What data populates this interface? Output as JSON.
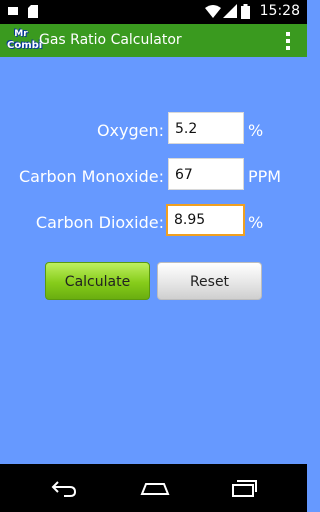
{
  "status_bar": {
    "time": "15:28"
  },
  "action_bar": {
    "logo_line1": "Mr",
    "logo_line2": "Combi",
    "title": "Gas Ratio Calculator"
  },
  "form": {
    "oxygen": {
      "label": "Oxygen:",
      "value": "5.2",
      "unit": "%"
    },
    "co": {
      "label": "Carbon Monoxide:",
      "value": "67",
      "unit": "PPM"
    },
    "co2": {
      "label": "Carbon Dioxide:",
      "value": "8.95",
      "unit": "%"
    }
  },
  "buttons": {
    "calculate": "Calculate",
    "reset": "Reset"
  },
  "icons": {
    "status": [
      "notification-icon",
      "sd-card-icon",
      "wifi-icon",
      "signal-icon",
      "battery-icon"
    ],
    "nav": [
      "back-icon",
      "home-icon",
      "recents-icon"
    ],
    "menu": "overflow-menu-icon"
  },
  "colors": {
    "background": "#6699ff",
    "action_bar": "#3a9a1f",
    "focus_border": "#f0a020",
    "calculate_button": "#86cc1a"
  }
}
